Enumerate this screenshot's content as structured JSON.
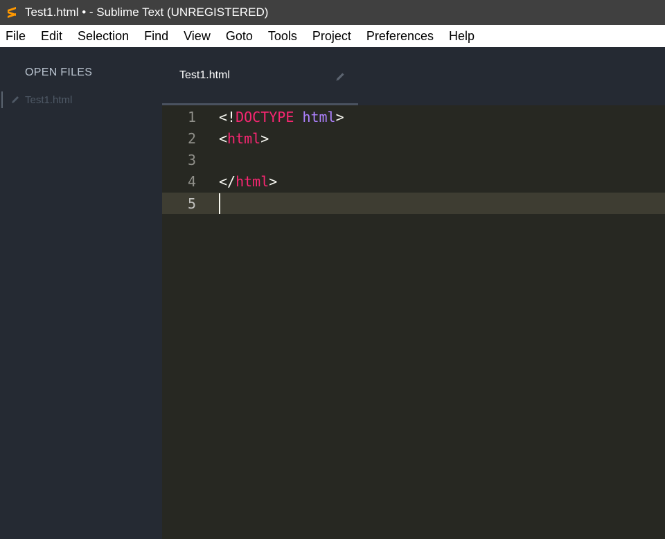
{
  "window": {
    "title": "Test1.html • - Sublime Text (UNREGISTERED)",
    "app_icon": "sublime-text-icon"
  },
  "menubar": {
    "items": [
      {
        "label": "File"
      },
      {
        "label": "Edit"
      },
      {
        "label": "Selection"
      },
      {
        "label": "Find"
      },
      {
        "label": "View"
      },
      {
        "label": "Goto"
      },
      {
        "label": "Tools"
      },
      {
        "label": "Project"
      },
      {
        "label": "Preferences"
      },
      {
        "label": "Help"
      }
    ]
  },
  "sidebar": {
    "heading": "OPEN FILES",
    "files": [
      {
        "name": "Test1.html",
        "icon": "pencil-icon"
      }
    ]
  },
  "tabs": [
    {
      "label": "Test1.html",
      "icon": "pencil-icon"
    }
  ],
  "editor": {
    "lines": [
      {
        "number": "1",
        "tokens": [
          [
            "punct",
            "<!"
          ],
          [
            "doctype",
            "DOCTYPE"
          ],
          [
            "punct",
            " "
          ],
          [
            "attr",
            "html"
          ],
          [
            "punct",
            ">"
          ]
        ]
      },
      {
        "number": "2",
        "tokens": [
          [
            "punct",
            "<"
          ],
          [
            "tag",
            "html"
          ],
          [
            "punct",
            ">"
          ]
        ]
      },
      {
        "number": "3",
        "tokens": []
      },
      {
        "number": "4",
        "tokens": [
          [
            "punct",
            "</"
          ],
          [
            "tag",
            "html"
          ],
          [
            "punct",
            ">"
          ]
        ]
      },
      {
        "number": "5",
        "tokens": [],
        "current": true
      }
    ]
  },
  "colors": {
    "editor_bg": "#272822",
    "sidebar_bg": "#252a33",
    "tag": "#f92672",
    "attribute": "#ae81ff",
    "punctuation": "#f8f8f2",
    "current_line": "#3e3d32"
  }
}
